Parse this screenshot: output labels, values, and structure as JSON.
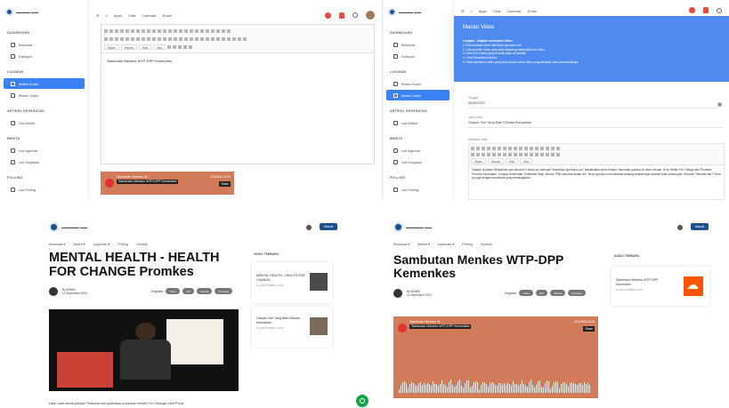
{
  "admin_sidebar": {
    "brand": "Website logo / brand",
    "sections": [
      {
        "title": "DASHBOARD",
        "items": [
          {
            "label": "Beranda"
          },
          {
            "label": "Kategori"
          }
        ]
      },
      {
        "title": "LAYANAN",
        "items": [
          {
            "label": "Materi Audio"
          },
          {
            "label": "Materi Video"
          }
        ]
      },
      {
        "title": "ARTIKEL KESEHATAN",
        "items": [
          {
            "label": "List Artikel"
          }
        ]
      },
      {
        "title": "BERITA",
        "items": [
          {
            "label": "List Agenda"
          },
          {
            "label": "List Kegiatan"
          }
        ]
      },
      {
        "title": "POLLING",
        "items": [
          {
            "label": "List Polling"
          }
        ]
      }
    ]
  },
  "admin_topbar": {
    "menu": [
      "Apps",
      "Chat",
      "Calendar",
      "Email"
    ]
  },
  "panel1": {
    "editor_text": "Sambutan Menkes WTP-DPP Kemenkes",
    "style_select": "Styles",
    "format_select": "Format",
    "font_select": "Font",
    "size_select": "Size",
    "video": {
      "line1": "Sambutan Menkes W...",
      "line2": "Sambutan Menkes WTP-DPP Kemenkes",
      "brand": "SOUNDCLOUD",
      "share": "Share"
    }
  },
  "panel2": {
    "card_title": "Master Video",
    "steps_title": "Langkah - langkah menambah Video:",
    "steps": [
      "1. Buka website resmi dari https://youtube.com",
      "2. Cari dan pilih Video yang akan dipasang/ ditampilkan ke Video",
      "3. Salin link embed yang tersedia pada url website",
      "4. Lihat Screenshot Berikut",
      "5. Paste alamat ke video yang telah disalin kanan video yang disimpan pada penambahnya"
    ],
    "date_label": "Tanggal",
    "date_value": "05/09/2022",
    "title_label": "Judul Video",
    "title_value": "Gasper Gizi Yang Baik Dikutas Kamadiran",
    "desc_label": "Deskripsi Video",
    "desc_text": "Cikaran di pasan Ramadhan sya kemarin? Lancar ya mainnya? Ahadbuyu apa kamu ya? Masakdalke kamu lemasi, Harundan godaha oh kamu lemasi. Di ini Health For Change dari Promkes Promosi Kesehatan, Junapar Kesehatan: Politeknik Negri Jember. Pilih sumanat badan teh. Terus sya kali ini membahas tentang sinjadan gizi selama bulan puasa gais. Gimana? Menarik kan? Terus ya juga dengan kebutuhan yang bersangkutan..."
  },
  "panel3": {
    "nav": [
      "Beranda ▾",
      "Berita ▾",
      "Layanan ▾",
      "Polling",
      "Kontak"
    ],
    "login": "Masuk",
    "title": "MENTAL HEALTH - HEALTH FOR CHANGE Promkes",
    "author": "By ADMIN",
    "date": "12 September 2022",
    "tags_label": "Kegiatan",
    "tags": [
      "Video",
      "Gizi",
      "Mental",
      "Promkes"
    ],
    "sidebar_heading": "VIDEO TERBARU",
    "side_items": [
      {
        "title": "MENTAL HEALTH - HEALTH FOR CHANGE...",
        "date": "12 SEPTEMBER 2022"
      },
      {
        "title": "Gasper Gizi Yang Baik Dikutas Kamadiran",
        "date": "12 SEPTEMBER 2022"
      }
    ],
    "excerpt": "Halo halo sobat pelajar Selamat menyaksikan produksi Health For Change oleh Prodi"
  },
  "panel4": {
    "nav": [
      "Beranda ▾",
      "Berita ▾",
      "Layanan ▾",
      "Polling",
      "Kontak"
    ],
    "login": "Masuk",
    "title": "Sambutan Menkes WTP-DPP Kemenkes",
    "author": "By ADMIN",
    "date": "12 September 2022",
    "tags_label": "Kegiatan",
    "tags": [
      "Video",
      "Gizi",
      "Mental",
      "Promkes"
    ],
    "sidebar_heading": "AUDIO TERBARU",
    "side_item": {
      "title": "Sambutan Menkes WTP-DPP Kemenkes",
      "date": "12 SEPTEMBER 2022"
    },
    "video": {
      "line1": "Sambutan Menkes W...",
      "line2": "Sambutan Menkes WTP-DPP Kemenkes",
      "brand": "SOUNDCLOUD",
      "share": "Share"
    }
  },
  "colors": {
    "primary": "#3b82f6",
    "brand_navy": "#1f4e8c",
    "accent_orange": "#d27b59",
    "soundcloud": "#ff5500",
    "fab_green": "#17a34a"
  }
}
